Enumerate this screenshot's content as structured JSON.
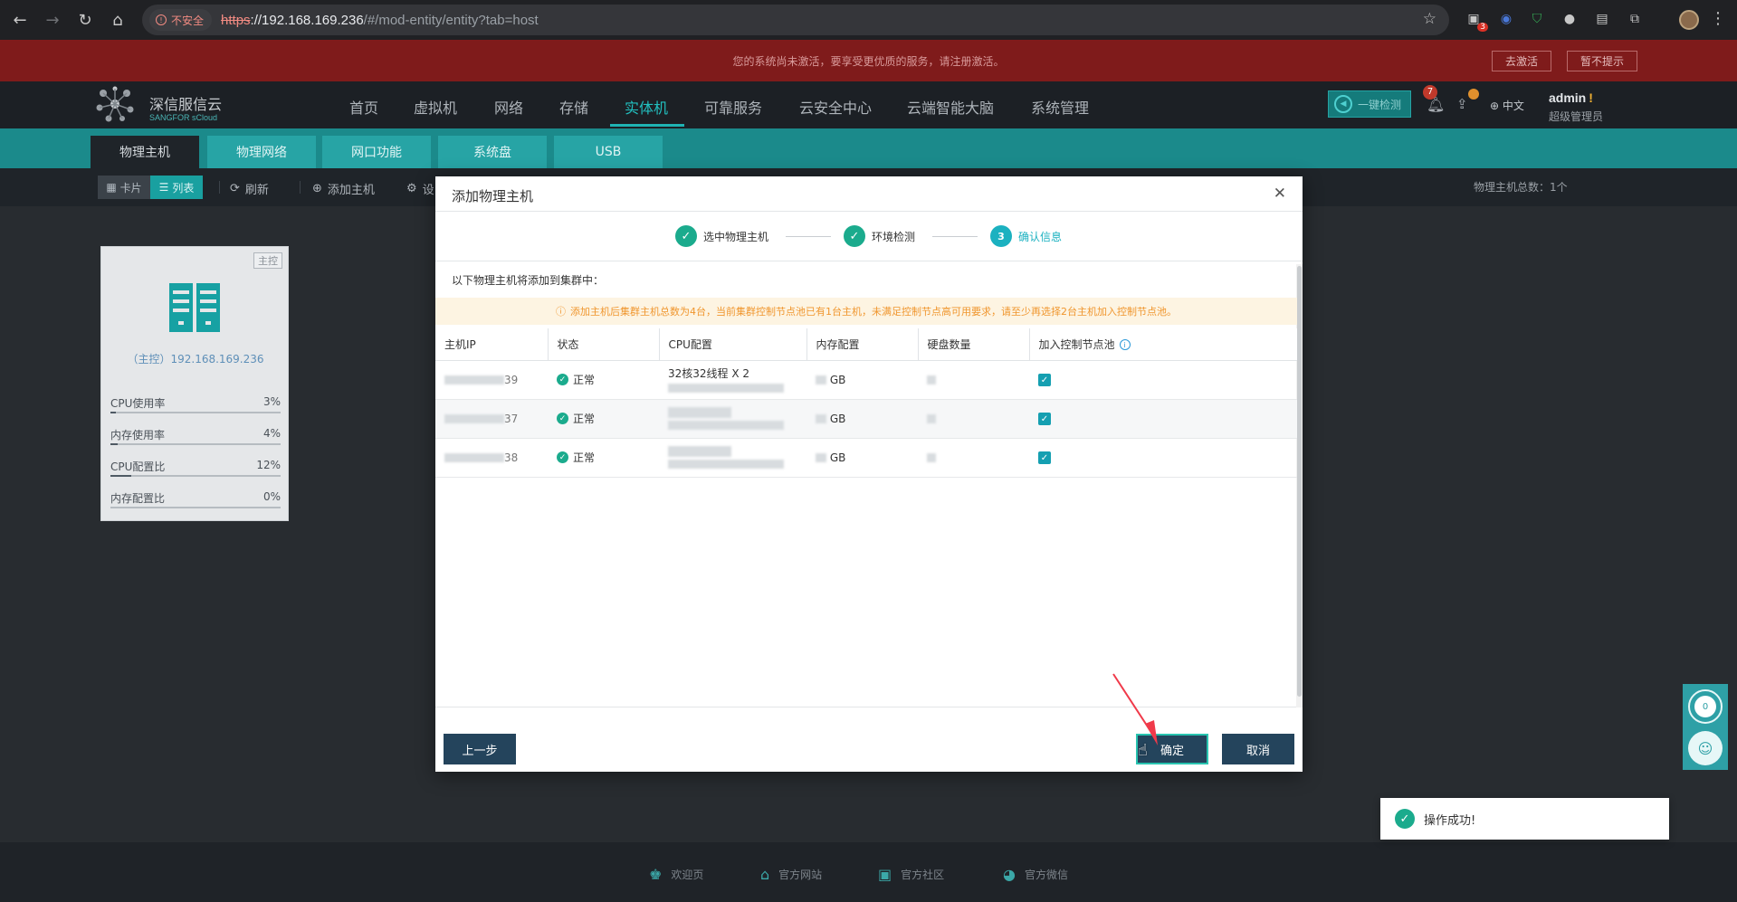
{
  "browser": {
    "insecure_label": "不安全",
    "url_scheme": "https",
    "url_host": "://192.168.169.236",
    "url_path": "/#/mod-entity/entity?tab=host",
    "ext_badge": "3"
  },
  "banner": {
    "text": "您的系统尚未激活，要享受更优质的服务，请注册激活。",
    "activate_label": "去激活",
    "dismiss_label": "暂不提示"
  },
  "header": {
    "logo_cn": "深信服信云",
    "logo_en": "SANGFOR sCloud",
    "nav": [
      "首页",
      "虚拟机",
      "网络",
      "存储",
      "实体机",
      "可靠服务",
      "云安全中心",
      "云端智能大脑",
      "系统管理"
    ],
    "active_nav": "实体机",
    "detect_label": "一键检测",
    "notif_count": "7",
    "lang": "中文",
    "user": "admin",
    "user_flag": "!",
    "role": "超级管理员"
  },
  "subtabs": [
    "物理主机",
    "物理网络",
    "网口功能",
    "系统盘",
    "USB"
  ],
  "toolbar": {
    "card_label": "卡片",
    "list_label": "列表",
    "refresh_label": "刷新",
    "add_host_label": "添加主机",
    "settings_label": "设",
    "host_total": "物理主机总数：1个"
  },
  "host_card": {
    "tag": "主控",
    "ip": "（主控）192.168.169.236",
    "metrics": [
      {
        "label": "CPU使用率",
        "value": "3%",
        "fraction": 0.03
      },
      {
        "label": "内存使用率",
        "value": "4%",
        "fraction": 0.04
      },
      {
        "label": "CPU配置比",
        "value": "12%",
        "fraction": 0.12
      },
      {
        "label": "内存配置比",
        "value": "0%",
        "fraction": 0.0
      }
    ]
  },
  "modal": {
    "title": "添加物理主机",
    "steps": [
      {
        "label": "选中物理主机",
        "state": "done"
      },
      {
        "label": "环境检测",
        "state": "done"
      },
      {
        "label": "确认信息",
        "state": "current",
        "number": "3"
      }
    ],
    "intro": "以下物理主机将添加到集群中：",
    "warning": "添加主机后集群主机总数为4台，当前集群控制节点池已有1台主机，未满足控制节点高可用要求，请至少再选择2台主机加入控制节点池。",
    "columns": [
      "主机IP",
      "状态",
      "CPU配置",
      "内存配置",
      "硬盘数量",
      "加入控制节点池"
    ],
    "rows": [
      {
        "ip_suffix": "39",
        "status": "正常",
        "cpu": "32核32线程 X 2",
        "mem_unit": "GB"
      },
      {
        "ip_suffix": "37",
        "status": "正常",
        "cpu": "",
        "mem_unit": "GB"
      },
      {
        "ip_suffix": "38",
        "status": "正常",
        "cpu": "",
        "mem_unit": "GB"
      }
    ],
    "prev_label": "上一步",
    "ok_label": "确定",
    "cancel_label": "取消"
  },
  "float_widget": {
    "count": "0"
  },
  "toast": {
    "text": "操作成功!"
  },
  "footer": [
    "欢迎页",
    "官方网站",
    "官方社区",
    "官方微信"
  ],
  "colors": {
    "teal": "#1b8a8b",
    "accent": "#1bb1c0",
    "banner": "#7f1b1b",
    "success": "#1bab8d",
    "warning": "#f0962e"
  }
}
